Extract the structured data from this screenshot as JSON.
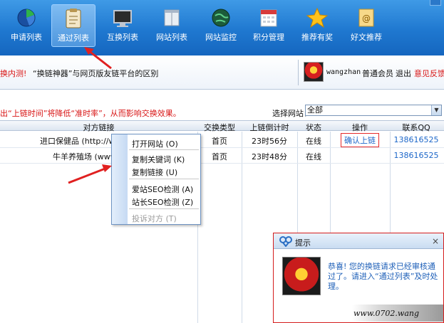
{
  "toolbar": {
    "items": [
      {
        "label": "申请列表",
        "icon": "pie-chart-icon"
      },
      {
        "label": "通过列表",
        "icon": "clipboard-icon",
        "active": true
      },
      {
        "label": "互换列表",
        "icon": "monitor-icon"
      },
      {
        "label": "网站列表",
        "icon": "window-icon"
      },
      {
        "label": "网站监控",
        "icon": "globe-icon"
      },
      {
        "label": "积分管理",
        "icon": "calendar-icon"
      },
      {
        "label": "推荐有奖",
        "icon": "star-icon"
      },
      {
        "label": "好文推荐",
        "icon": "mail-icon"
      }
    ]
  },
  "notice": {
    "red_text": "换内测!",
    "text": "“换链神器”与网页版友链平台的区别"
  },
  "user": {
    "name": "wangzhan",
    "level": "普通会员",
    "logout": "退出",
    "feedback": "意见反馈"
  },
  "warning": "出“上链时间”将降低“准时率”，从而影响交换效果。",
  "site_select": {
    "label": "选择网站：",
    "value": "全部"
  },
  "table": {
    "headers": [
      "对方链接",
      "交换类型",
      "上链倒计时",
      "状态",
      "操作",
      "联系QQ"
    ],
    "rows": [
      {
        "link": "进口保健品 (http://www",
        "type": "首页",
        "countdown": "23时56分",
        "status": "在线",
        "action": "确认上链",
        "qq": "138616525"
      },
      {
        "link": "牛羊养殖场 (www.n",
        "type": "首页",
        "countdown": "23时48分",
        "status": "在线",
        "action": "",
        "qq": "138616525"
      }
    ]
  },
  "context_menu": {
    "items": [
      {
        "label": "打开网站 (O)",
        "disabled": false
      },
      {
        "label": "复制关键词 (K)",
        "disabled": false
      },
      {
        "label": "复制链接 (U)",
        "disabled": false
      },
      {
        "label": "爱站SEO检测 (A)",
        "disabled": false
      },
      {
        "label": "站长SEO检测 (Z)",
        "disabled": false
      },
      {
        "label": "投诉对方 (T)",
        "disabled": true
      }
    ]
  },
  "popup": {
    "title": "提示",
    "close": "×",
    "message": "恭喜! 您的换链请求已经审核通过了。请进入“通过列表”及时处理。",
    "watermark": "www.0702.wang"
  },
  "colors": {
    "toolbar_blue": "#1f78d0",
    "red": "#d81414",
    "link_blue": "#1d67c9"
  }
}
